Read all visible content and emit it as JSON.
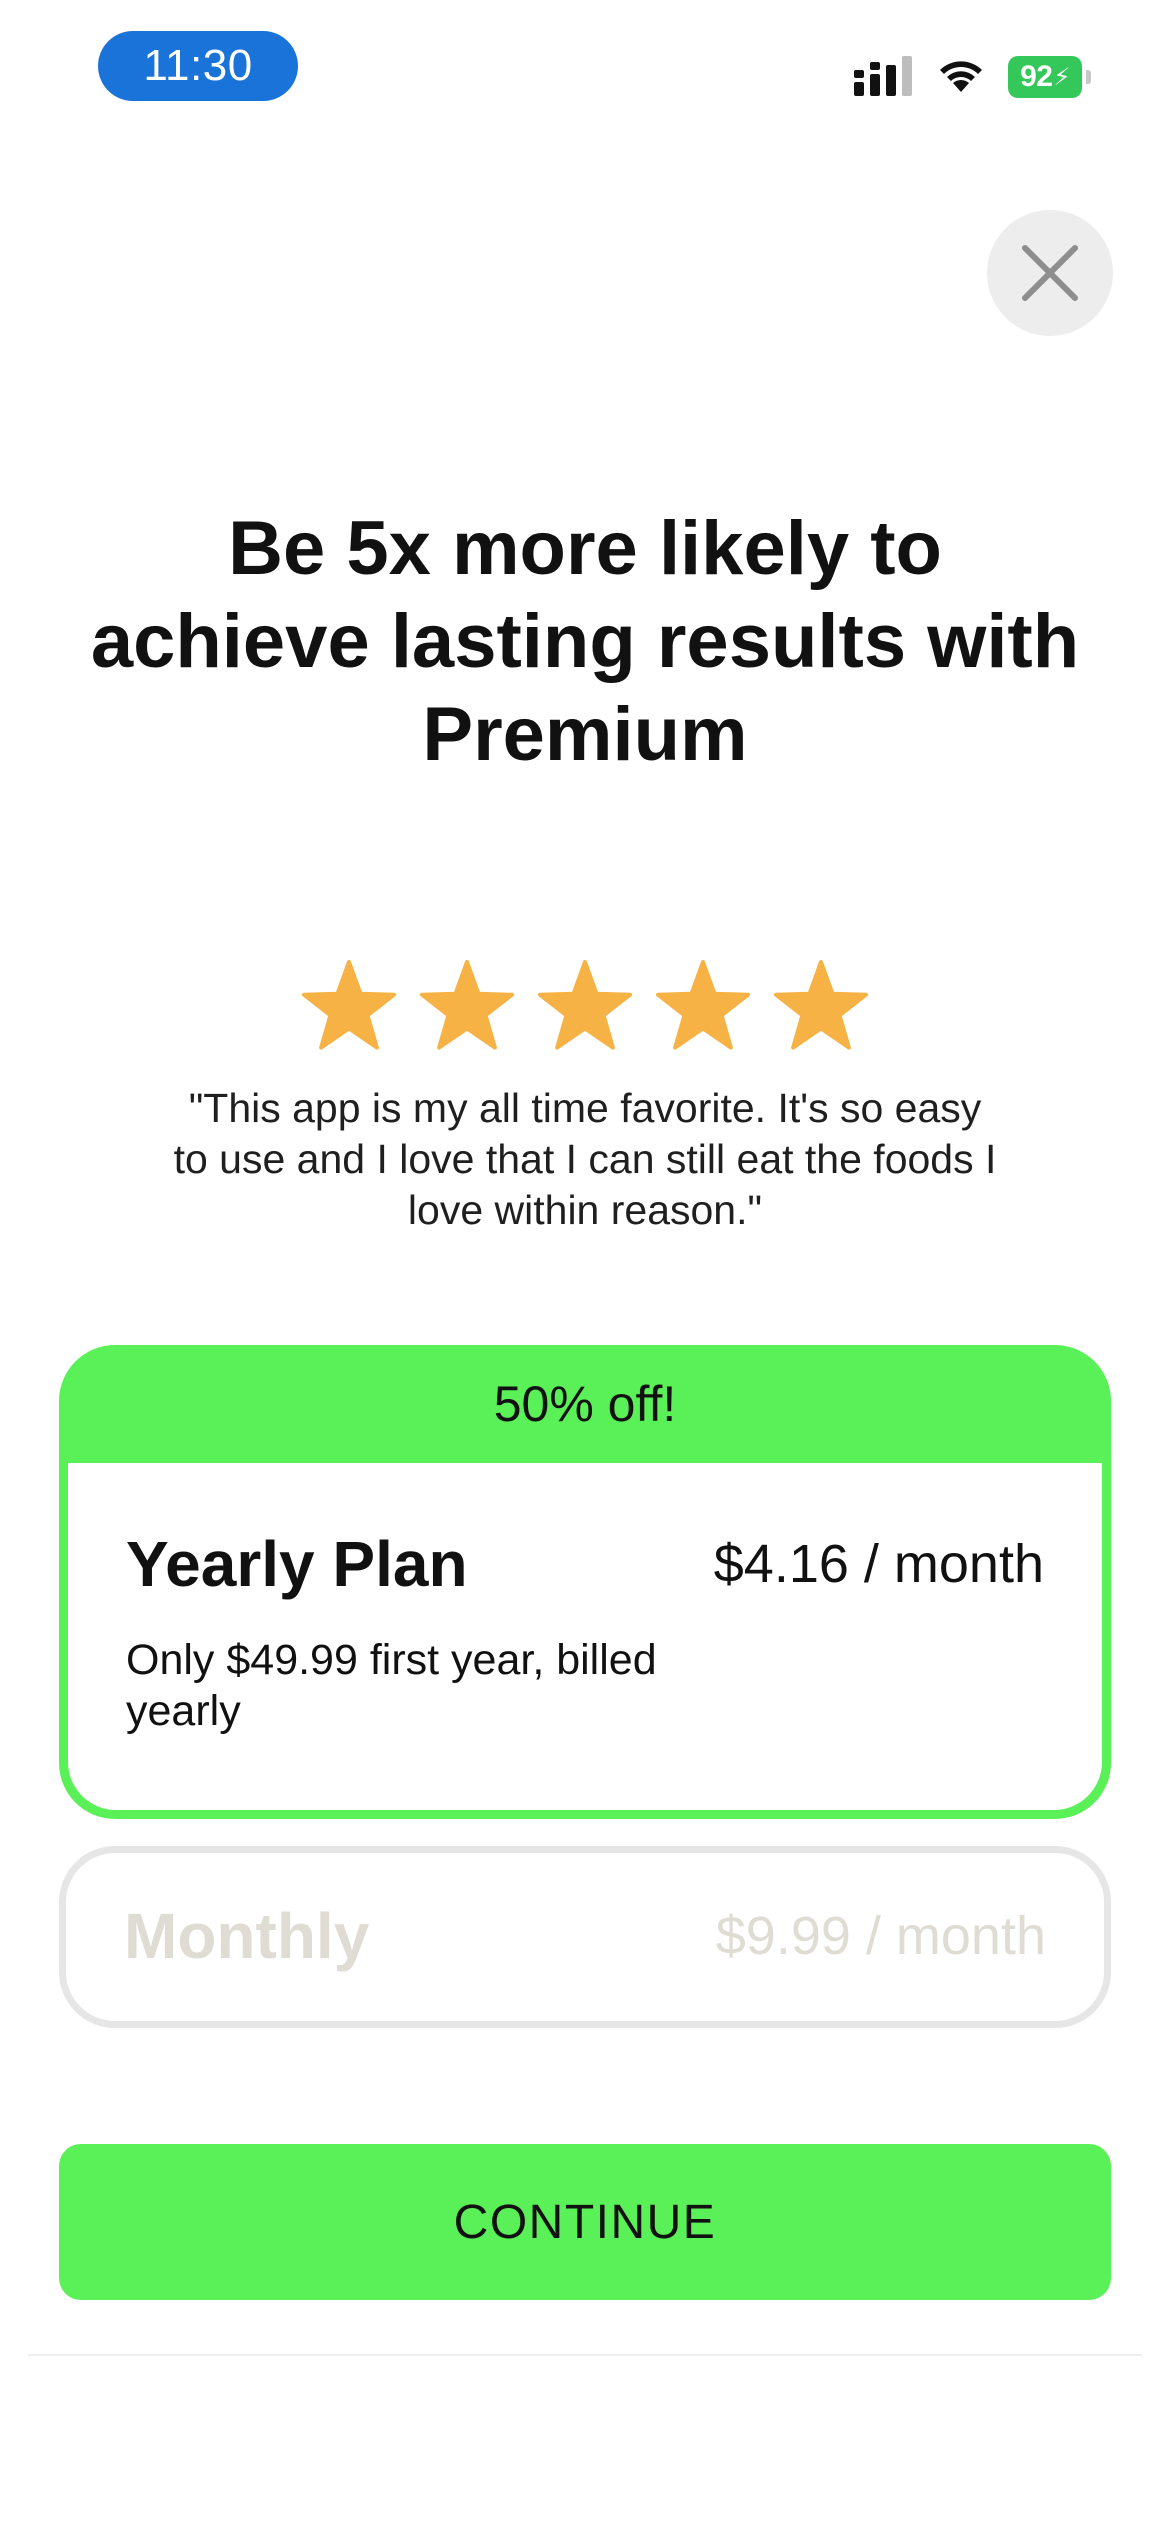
{
  "status_bar": {
    "time": "11:30",
    "battery": "92",
    "icons": [
      "signal-icon",
      "wifi-icon",
      "battery-charging-icon"
    ]
  },
  "close_icon": "close-icon",
  "headline": "Be 5x more likely to achieve lasting results with Premium",
  "rating": {
    "stars": 5,
    "max": 5,
    "star_color": "#f6b244"
  },
  "testimonial": "\"This app is my all time favorite. It's so easy to use and I love that I can still eat the foods I love within reason.\"",
  "plans": {
    "yearly": {
      "badge": "50% off!",
      "title": "Yearly Plan",
      "price": "$4.16 / month",
      "description": "Only $49.99 first year, billed yearly",
      "selected": true
    },
    "monthly": {
      "title": "Monthly",
      "price": "$9.99 / month",
      "selected": false
    }
  },
  "continue_label": "CONTINUE",
  "colors": {
    "accent": "#5af058",
    "time_pill": "#1a73d9",
    "battery": "#34c759",
    "disabled_text": "#dfdcd4"
  }
}
